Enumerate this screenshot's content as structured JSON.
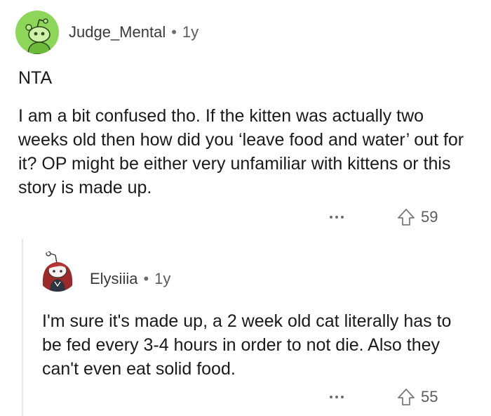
{
  "comments": [
    {
      "username": "Judge_Mental",
      "separator": "•",
      "age": "1y",
      "avatar_icon": "snoo-avatar-green",
      "avatar_bg": "#8ed65a",
      "paragraphs": [
        "NTA",
        "I am a bit confused tho. If the kitten was actually two weeks old then how did you ‘leave food and water’ out for it? OP might be either very unfamiliar with kittens or this story is made up."
      ],
      "more_icon": "more-options-icon",
      "upvote_icon": "upvote-arrow-icon",
      "votes": "59"
    },
    {
      "username": "Elysiiia",
      "separator": "•",
      "age": "1y",
      "avatar_icon": "snoo-avatar-red-hair",
      "paragraphs": [
        "I'm sure it's made up, a 2 week old cat literally has to be fed every 3-4 hours in order to not die. Also they can't even eat solid food."
      ],
      "more_icon": "more-options-icon",
      "upvote_icon": "upvote-arrow-icon",
      "votes": "55"
    }
  ]
}
